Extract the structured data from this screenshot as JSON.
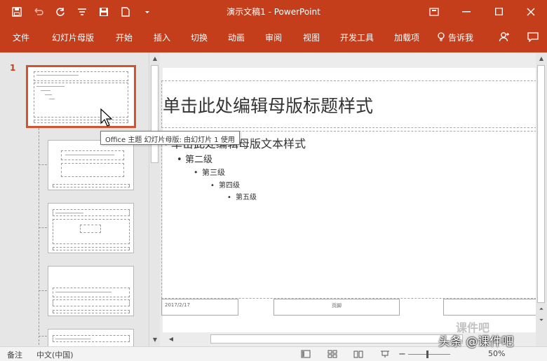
{
  "window": {
    "title": "演示文稿1 - PowerPoint"
  },
  "quick_access": [
    "save-icon",
    "undo-icon",
    "redo-icon",
    "touch-mode-icon",
    "save-as-icon",
    "new-file-icon",
    "customize-icon"
  ],
  "ribbon_tabs": [
    "文件",
    "幻灯片母版",
    "开始",
    "插入",
    "切换",
    "动画",
    "审阅",
    "视图",
    "开发工具",
    "加载项"
  ],
  "tell_me": "告诉我",
  "thumbnails": {
    "first_number": "1",
    "tooltip": "Office 主题 幻灯片母版: 由幻灯片 1 使用"
  },
  "slide": {
    "title": "单击此处编辑母版标题样式",
    "level1": "单击此处编辑母版文本样式",
    "level2": "第二级",
    "level3": "第三级",
    "level4": "第四级",
    "level5": "第五级",
    "footer_date": "2017/2/17",
    "footer_center": "页脚"
  },
  "status": {
    "notes": "备注",
    "language": "中文(中国)",
    "zoom": "50%"
  },
  "watermark": {
    "text": "头条 @课件吧",
    "logo": "课件吧"
  },
  "colors": {
    "accent": "#c43e1c",
    "thumb_selected": "#d35230"
  }
}
